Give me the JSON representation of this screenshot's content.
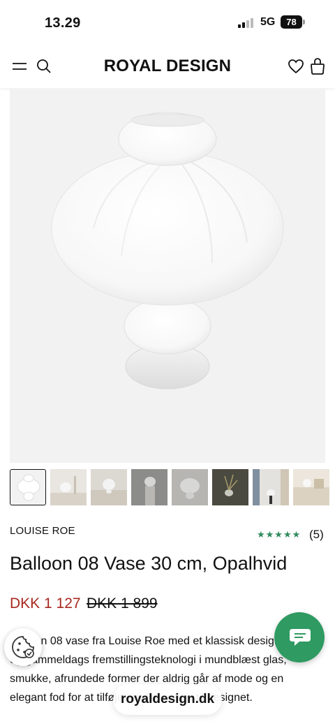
{
  "status_bar": {
    "time": "13.29",
    "network": "5G",
    "battery": "78"
  },
  "header": {
    "brand": "ROYAL DESIGN"
  },
  "product": {
    "brand": "LOUISE ROE",
    "rating_stars": "★★★★★",
    "rating_count": "(5)",
    "title": "Balloon 08 Vase 30 cm, Opalhvid",
    "price_sale": "DKK 1 127",
    "price_original": "DKK 1 899",
    "description_lines": [
      "Balloon 08 vase fra Louise Roe med et klassisk design,",
      "og gammeldags fremstillingsteknologi i mundblæst glas,",
      "smukke, afrundede former der aldrig går af mode og en",
      "elegant fod for at tilføje en dimension til designet."
    ]
  },
  "gallery": {
    "thumbnail_count": 8,
    "active_index": 0
  },
  "browser": {
    "url": "royaldesign.dk"
  },
  "colors": {
    "accent_price": "#a8281e",
    "stars": "#2f8a5c",
    "chat": "#2f9a62"
  }
}
